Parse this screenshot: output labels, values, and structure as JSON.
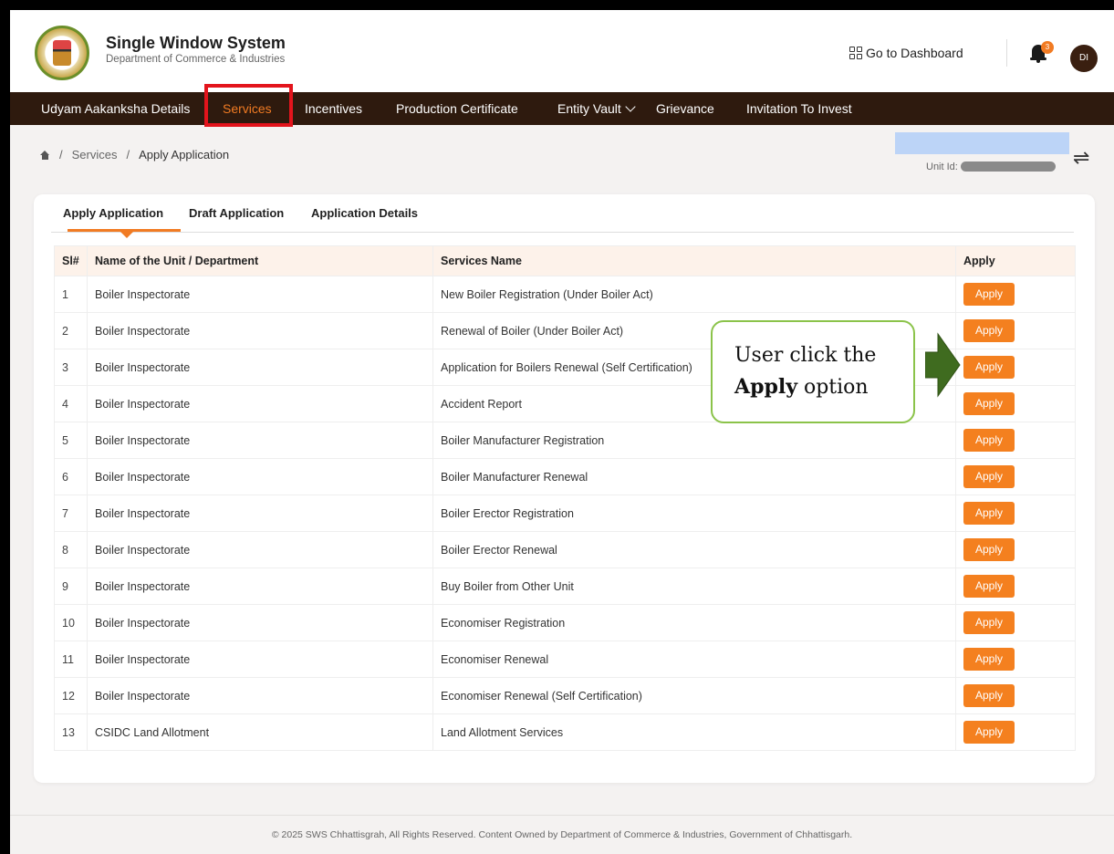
{
  "header": {
    "title": "Single Window System",
    "subtitle": "Department of Commerce & Industries",
    "dashboard_label": "Go to Dashboard",
    "notification_count": "3",
    "avatar_initials": "DI"
  },
  "nav": {
    "items": [
      "Udyam Aakanksha Details",
      "Services",
      "Incentives",
      "Production Certificate",
      "Entity Vault",
      "Grievance",
      "Invitation To Invest"
    ],
    "active": "Services"
  },
  "breadcrumb": {
    "items": [
      "Services",
      "Apply Application"
    ]
  },
  "unit": {
    "label": "Unit Id:"
  },
  "tabs": [
    "Apply Application",
    "Draft Application",
    "Application Details"
  ],
  "table": {
    "headers": [
      "Sl#",
      "Name of the Unit / Department",
      "Services Name",
      "Apply"
    ],
    "button_label": "Apply",
    "rows": [
      {
        "sl": "1",
        "unit": "Boiler Inspectorate",
        "service": "New Boiler Registration (Under Boiler Act)"
      },
      {
        "sl": "2",
        "unit": "Boiler Inspectorate",
        "service": "Renewal of Boiler (Under Boiler Act)"
      },
      {
        "sl": "3",
        "unit": "Boiler Inspectorate",
        "service": "Application for Boilers Renewal (Self Certification)"
      },
      {
        "sl": "4",
        "unit": "Boiler Inspectorate",
        "service": "Accident Report"
      },
      {
        "sl": "5",
        "unit": "Boiler Inspectorate",
        "service": "Boiler Manufacturer Registration"
      },
      {
        "sl": "6",
        "unit": "Boiler Inspectorate",
        "service": "Boiler Manufacturer Renewal"
      },
      {
        "sl": "7",
        "unit": "Boiler Inspectorate",
        "service": "Boiler Erector Registration"
      },
      {
        "sl": "8",
        "unit": "Boiler Inspectorate",
        "service": "Boiler Erector Renewal"
      },
      {
        "sl": "9",
        "unit": "Boiler Inspectorate",
        "service": "Buy Boiler from Other Unit"
      },
      {
        "sl": "10",
        "unit": "Boiler Inspectorate",
        "service": "Economiser Registration"
      },
      {
        "sl": "11",
        "unit": "Boiler Inspectorate",
        "service": "Economiser Renewal"
      },
      {
        "sl": "12",
        "unit": "Boiler Inspectorate",
        "service": "Economiser Renewal (Self Certification)"
      },
      {
        "sl": "13",
        "unit": "CSIDC Land Allotment",
        "service": "Land Allotment Services"
      }
    ]
  },
  "callout": {
    "line1": "User click the",
    "bold": "Apply",
    "rest": " option"
  },
  "footer": {
    "text": "© 2025 SWS Chhattisgrah, All Rights Reserved. Content Owned by Department of Commerce & Industries, Government of Chhattisgarh."
  },
  "colors": {
    "accent": "#f4801f",
    "nav_bg": "#2e1a0e",
    "highlight": "#e3141c",
    "callout_border": "#8bc34a",
    "callout_arrow": "#3f6b1f"
  }
}
